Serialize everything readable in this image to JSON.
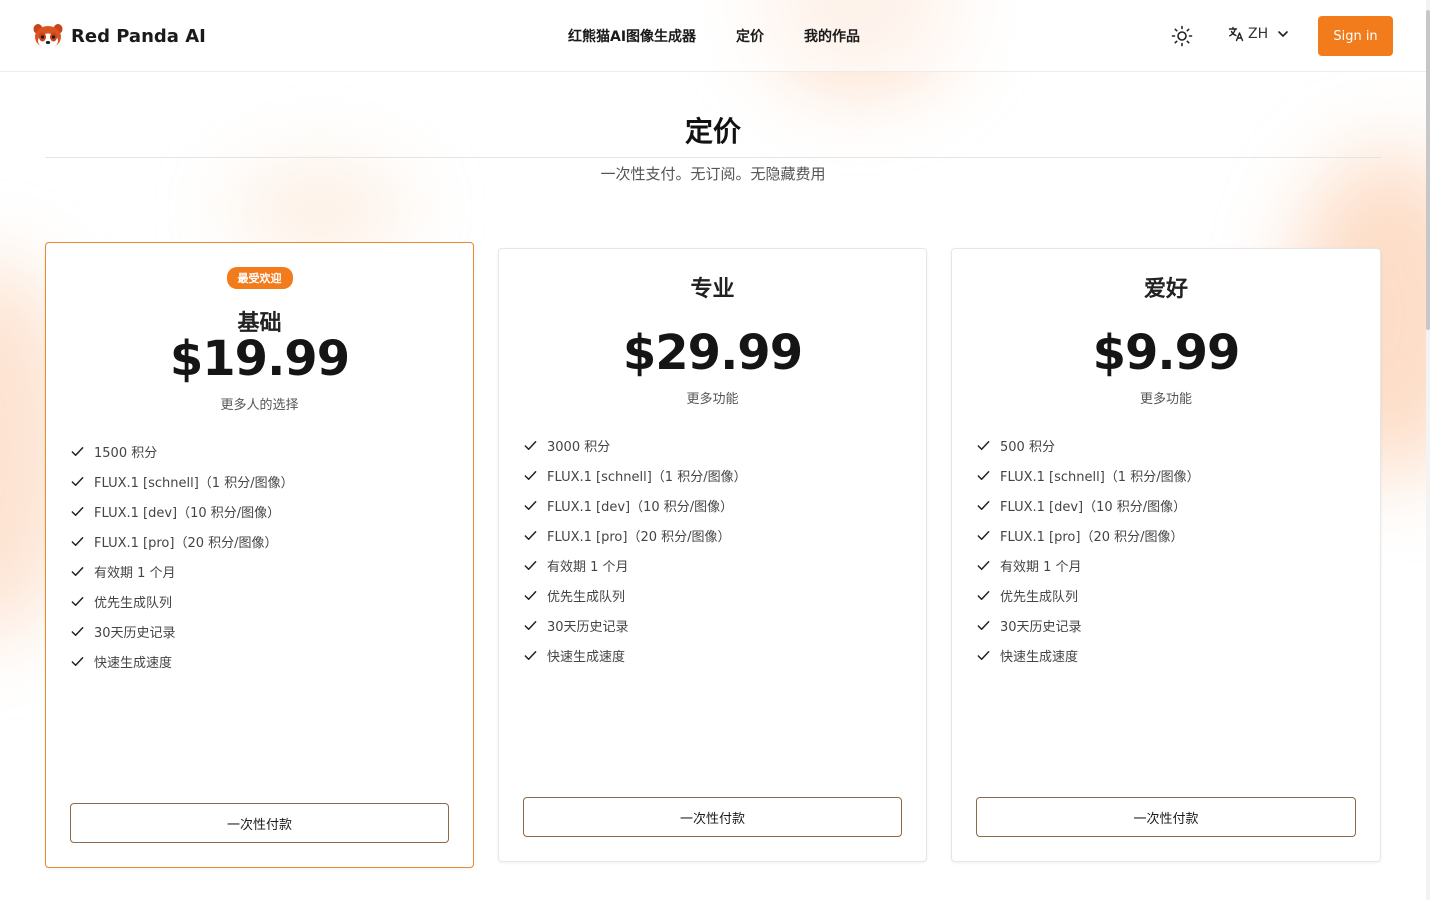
{
  "header": {
    "brand_name": "Red Panda AI",
    "nav": [
      "红熊猫AI图像生成器",
      "定价",
      "我的作品"
    ],
    "lang_label": "ZH",
    "signin_label": "Sign in"
  },
  "page": {
    "title": "定价",
    "subtitle": "一次性支付。无订阅。无隐藏费用"
  },
  "colors": {
    "accent": "#f27c1c",
    "featured_border": "#e88a2e"
  },
  "plans": [
    {
      "badge": "最受欢迎",
      "name": "基础",
      "price": "$19.99",
      "desc": "更多人的选择",
      "features": [
        "1500 积分",
        "FLUX.1 [schnell]（1 积分/图像）",
        "FLUX.1 [dev]（10 积分/图像）",
        "FLUX.1 [pro]（20 积分/图像）",
        "有效期 1 个月",
        "优先生成队列",
        "30天历史记录",
        "快速生成速度"
      ],
      "button": "一次性付款"
    },
    {
      "name": "专业",
      "price": "$29.99",
      "desc": "更多功能",
      "features": [
        "3000 积分",
        "FLUX.1 [schnell]（1 积分/图像）",
        "FLUX.1 [dev]（10 积分/图像）",
        "FLUX.1 [pro]（20 积分/图像）",
        "有效期 1 个月",
        "优先生成队列",
        "30天历史记录",
        "快速生成速度"
      ],
      "button": "一次性付款"
    },
    {
      "name": "爱好",
      "price": "$9.99",
      "desc": "更多功能",
      "features": [
        "500 积分",
        "FLUX.1 [schnell]（1 积分/图像）",
        "FLUX.1 [dev]（10 积分/图像）",
        "FLUX.1 [pro]（20 积分/图像）",
        "有效期 1 个月",
        "优先生成队列",
        "30天历史记录",
        "快速生成速度"
      ],
      "button": "一次性付款"
    }
  ]
}
